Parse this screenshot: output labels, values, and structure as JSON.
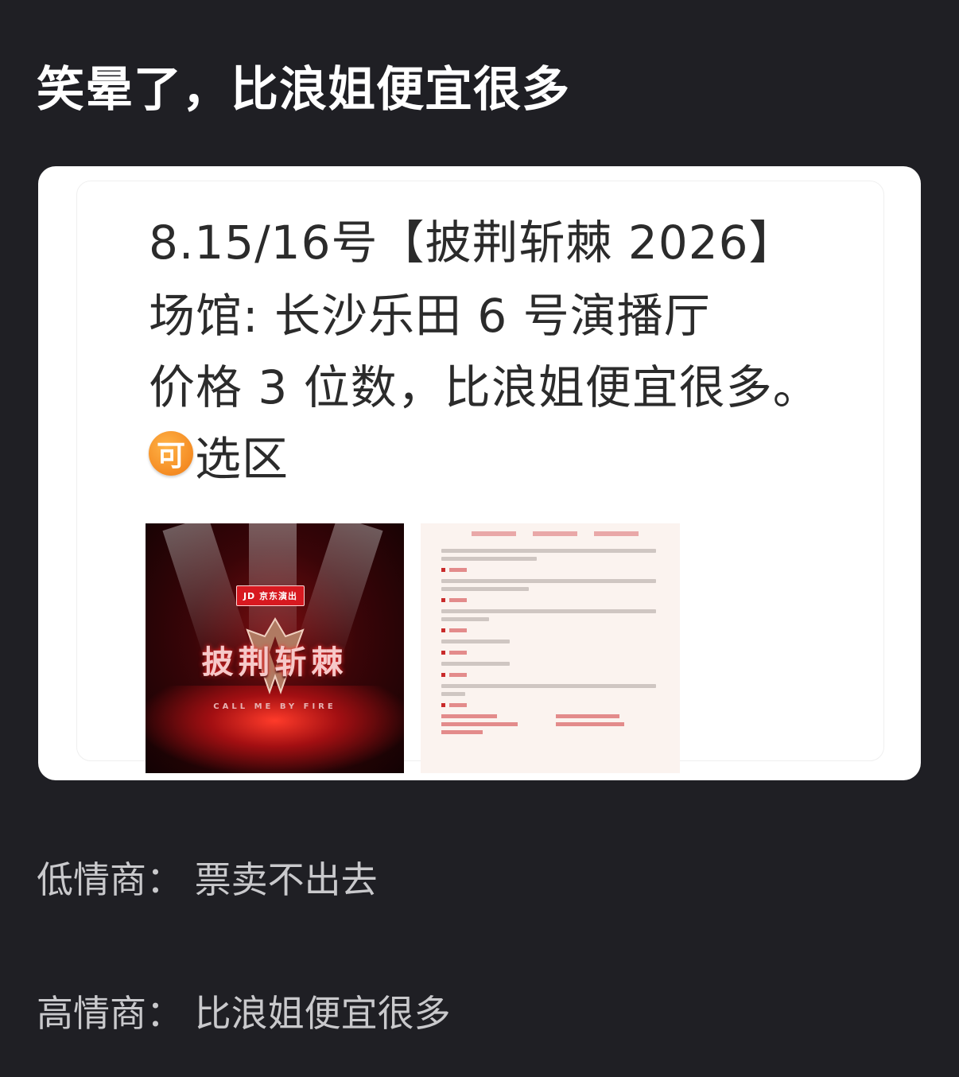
{
  "post": {
    "title": "笑晕了，比浪姐便宜很多"
  },
  "card": {
    "line1": "8.15/16号【披荆斩棘 2026】",
    "line2": "场馆: 长沙乐田 6 号演播厅",
    "line3": "价格 3 位数，比浪姐便宜很多。",
    "badge": "可",
    "line4": "选区",
    "poster": {
      "logo_text": "JD 京东演出",
      "title": "披荆斩棘",
      "subtitle": "CALL ME BY FIRE"
    }
  },
  "comments": {
    "low_eq": "低情商：  票卖不出去",
    "high_eq": "高情商：  比浪姐便宜很多"
  },
  "colors": {
    "background": "#1f1f24",
    "card": "#ffffff",
    "badge": "#f07b14"
  }
}
